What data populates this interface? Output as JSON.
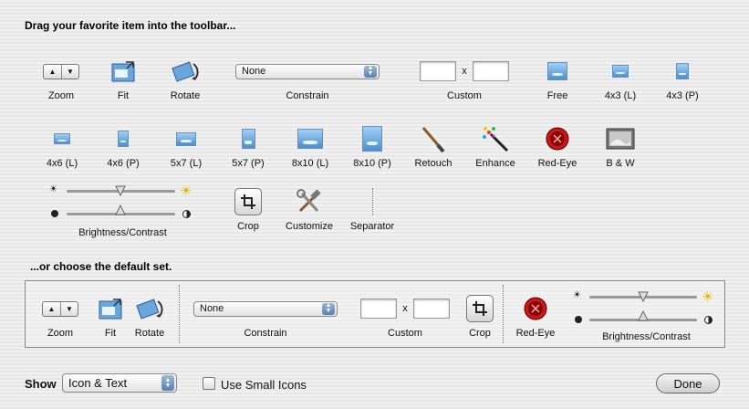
{
  "headings": {
    "drag": "Drag your favorite item into the toolbar...",
    "default": "...or choose the default set."
  },
  "palette": {
    "zoom": "Zoom",
    "fit": "Fit",
    "rotate": "Rotate",
    "constrain": "Constrain",
    "constrain_value": "None",
    "custom": "Custom",
    "custom_x": "x",
    "free": "Free",
    "r4x3l": "4x3 (L)",
    "r4x3p": "4x3 (P)",
    "r4x6l": "4x6 (L)",
    "r4x6p": "4x6 (P)",
    "r5x7l": "5x7 (L)",
    "r5x7p": "5x7 (P)",
    "r8x10l": "8x10 (L)",
    "r8x10p": "8x10 (P)",
    "retouch": "Retouch",
    "enhance": "Enhance",
    "redeye": "Red-Eye",
    "bw": "B & W",
    "brightness": "Brightness/Contrast",
    "crop": "Crop",
    "customize": "Customize",
    "separator": "Separator"
  },
  "default_set": {
    "zoom": "Zoom",
    "fit": "Fit",
    "rotate": "Rotate",
    "constrain": "Constrain",
    "constrain_value": "None",
    "custom": "Custom",
    "custom_x": "x",
    "crop": "Crop",
    "redeye": "Red-Eye",
    "brightness": "Brightness/Contrast"
  },
  "footer": {
    "show_label": "Show",
    "show_value": "Icon & Text",
    "small_icons": "Use Small Icons",
    "small_icons_checked": false,
    "done": "Done"
  },
  "colors": {
    "accent": "#5a7fb4",
    "redeye": "#c81818"
  },
  "icons": [
    "zoom-segment",
    "fit-icon",
    "rotate-icon",
    "photo-icon",
    "retouch-brush-icon",
    "enhance-wand-icon",
    "redeye-icon",
    "bw-icon",
    "sun-icon",
    "contrast-icon",
    "crop-icon",
    "customize-tools-icon"
  ]
}
